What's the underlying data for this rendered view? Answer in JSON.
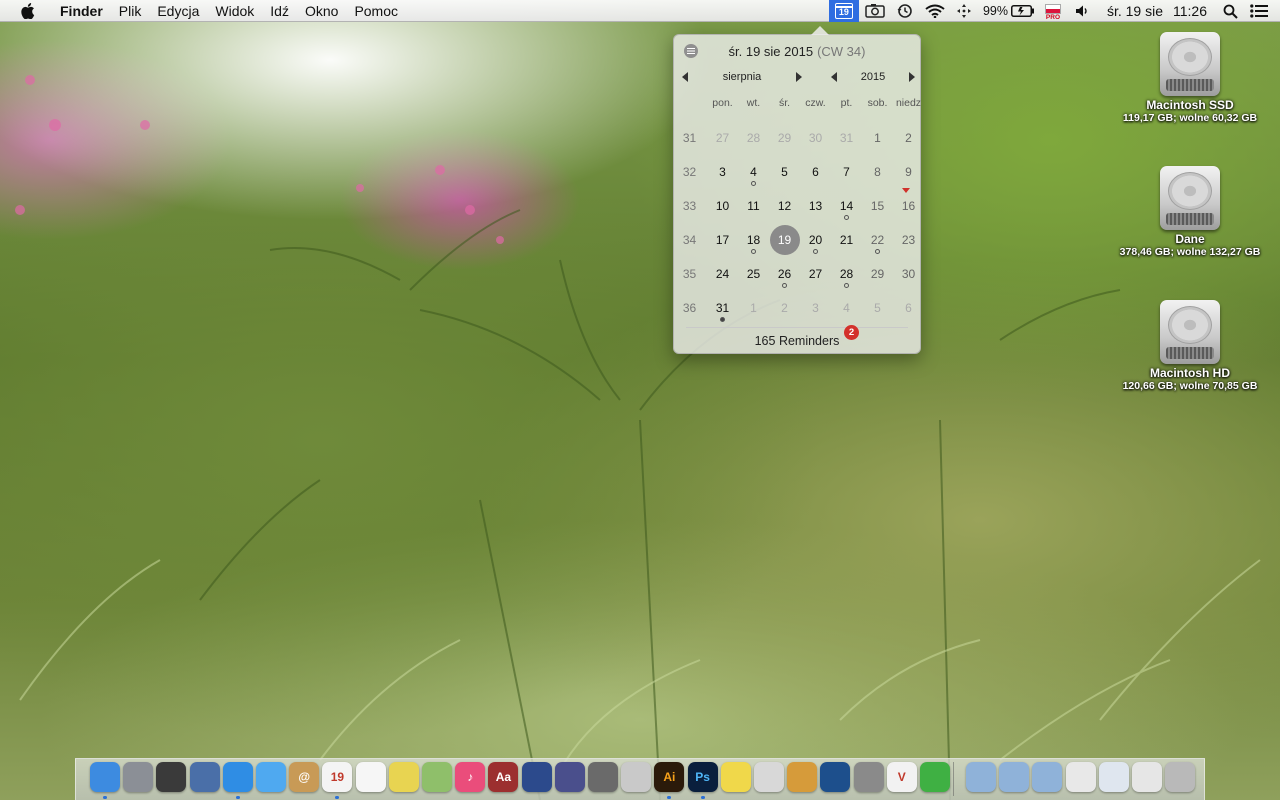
{
  "menubar": {
    "app_name": "Finder",
    "menus": [
      "Plik",
      "Edycja",
      "Widok",
      "Idź",
      "Okno",
      "Pomoc"
    ],
    "status": {
      "calendar_icon_day": "19",
      "battery": "99%",
      "input_source_badge": "PRO",
      "date": "śr. 19 sie",
      "time": "11:26"
    }
  },
  "calendar_popover": {
    "header_date": "śr. 19 sie 2015",
    "header_week": "(CW 34)",
    "month": "sierpnia",
    "year": "2015",
    "weekdays": [
      "pon.",
      "wt.",
      "śr.",
      "czw.",
      "pt.",
      "sob.",
      "niedz"
    ],
    "rows": [
      {
        "week": "31",
        "days": [
          {
            "d": "27",
            "other": true
          },
          {
            "d": "28",
            "other": true
          },
          {
            "d": "29",
            "other": true
          },
          {
            "d": "30",
            "other": true
          },
          {
            "d": "31",
            "other": true
          },
          {
            "d": "1"
          },
          {
            "d": "2"
          }
        ]
      },
      {
        "week": "32",
        "days": [
          {
            "d": "3"
          },
          {
            "d": "4",
            "dot": "open"
          },
          {
            "d": "5"
          },
          {
            "d": "6"
          },
          {
            "d": "7"
          },
          {
            "d": "8"
          },
          {
            "d": "9"
          }
        ]
      },
      {
        "week": "33",
        "days": [
          {
            "d": "10"
          },
          {
            "d": "11"
          },
          {
            "d": "12"
          },
          {
            "d": "13"
          },
          {
            "d": "14",
            "dot": "open"
          },
          {
            "d": "15"
          },
          {
            "d": "16",
            "flag": true
          }
        ]
      },
      {
        "week": "34",
        "days": [
          {
            "d": "17"
          },
          {
            "d": "18",
            "dot": "open"
          },
          {
            "d": "19",
            "today": true
          },
          {
            "d": "20",
            "dot": "open"
          },
          {
            "d": "21"
          },
          {
            "d": "22",
            "dot": "open"
          },
          {
            "d": "23"
          }
        ]
      },
      {
        "week": "35",
        "days": [
          {
            "d": "24"
          },
          {
            "d": "25"
          },
          {
            "d": "26",
            "dot": "open"
          },
          {
            "d": "27"
          },
          {
            "d": "28",
            "dot": "open"
          },
          {
            "d": "29"
          },
          {
            "d": "30"
          }
        ]
      },
      {
        "week": "36",
        "days": [
          {
            "d": "31",
            "dot": "filled"
          },
          {
            "d": "1",
            "other": true
          },
          {
            "d": "2",
            "other": true
          },
          {
            "d": "3",
            "other": true
          },
          {
            "d": "4",
            "other": true
          },
          {
            "d": "5",
            "other": true
          },
          {
            "d": "6",
            "other": true
          }
        ]
      }
    ],
    "reminders_label": "165 Reminders",
    "reminders_badge": "2"
  },
  "desktop": {
    "drives": [
      {
        "name": "Macintosh SSD",
        "info": "119,17 GB; wolne 60,32 GB"
      },
      {
        "name": "Dane",
        "info": "378,46 GB; wolne 132,27 GB"
      },
      {
        "name": "Macintosh HD",
        "info": "120,66 GB; wolne 70,85 GB"
      }
    ]
  },
  "dock": {
    "apps": [
      {
        "name": "finder-icon",
        "color": "#3d8be0",
        "label": "",
        "running": true
      },
      {
        "name": "launchpad-icon",
        "color": "#8b8f96",
        "label": ""
      },
      {
        "name": "dashboard-icon",
        "color": "#3a3a3a",
        "label": ""
      },
      {
        "name": "preview-icon",
        "color": "#4a6fa8",
        "label": ""
      },
      {
        "name": "safari-icon",
        "color": "#2f8de4",
        "label": "",
        "running": true
      },
      {
        "name": "messages-icon",
        "color": "#4fa9f0",
        "label": ""
      },
      {
        "name": "contacts-icon",
        "color": "#c89a56",
        "label": "@"
      },
      {
        "name": "calendar-icon",
        "color": "#f4f4f4",
        "label": "19",
        "running": true
      },
      {
        "name": "reminders-icon",
        "color": "#f6f6f6",
        "label": ""
      },
      {
        "name": "stickies-icon",
        "color": "#e8d451",
        "label": ""
      },
      {
        "name": "maps-icon",
        "color": "#8fbf6a",
        "label": ""
      },
      {
        "name": "itunes-icon",
        "color": "#ea4d7b",
        "label": "♪"
      },
      {
        "name": "dictionary-icon",
        "color": "#9c2f2f",
        "label": "Aa"
      },
      {
        "name": "language-icon",
        "color": "#2c4a8c",
        "label": ""
      },
      {
        "name": "quill-icon",
        "color": "#4a4f8c",
        "label": ""
      },
      {
        "name": "utility-icon",
        "color": "#6a6a6a",
        "label": ""
      },
      {
        "name": "calculator-icon",
        "color": "#c9c9c9",
        "label": ""
      },
      {
        "name": "illustrator-icon",
        "color": "#2b1a0a",
        "label": "Ai",
        "running": true
      },
      {
        "name": "photoshop-icon",
        "color": "#0a1f3d",
        "label": "Ps",
        "running": true
      },
      {
        "name": "notes-icon",
        "color": "#f0d84a",
        "label": ""
      },
      {
        "name": "documents-icon",
        "color": "#d8d8d8",
        "label": ""
      },
      {
        "name": "magnifier-icon",
        "color": "#d69b3a",
        "label": ""
      },
      {
        "name": "network-icon",
        "color": "#1d4f8c",
        "label": ""
      },
      {
        "name": "system-preferences-icon",
        "color": "#8a8a8a",
        "label": ""
      },
      {
        "name": "vectorize-icon",
        "color": "#f2f2f2",
        "label": "V"
      },
      {
        "name": "evernote-icon",
        "color": "#3fb043",
        "label": ""
      }
    ],
    "stacks": [
      {
        "name": "applications-folder-icon",
        "color": "#8fb2d9"
      },
      {
        "name": "documents-folder-icon",
        "color": "#8fb2d9"
      },
      {
        "name": "downloads-folder-icon",
        "color": "#8fb2d9"
      },
      {
        "name": "file-stack-icon",
        "color": "#e8e8e8"
      },
      {
        "name": "screenshot-stack-icon",
        "color": "#dfe6ef"
      },
      {
        "name": "spreadsheet-stack-icon",
        "color": "#e6e6e6"
      },
      {
        "name": "trash-icon",
        "color": "#b9b9b9"
      }
    ]
  }
}
